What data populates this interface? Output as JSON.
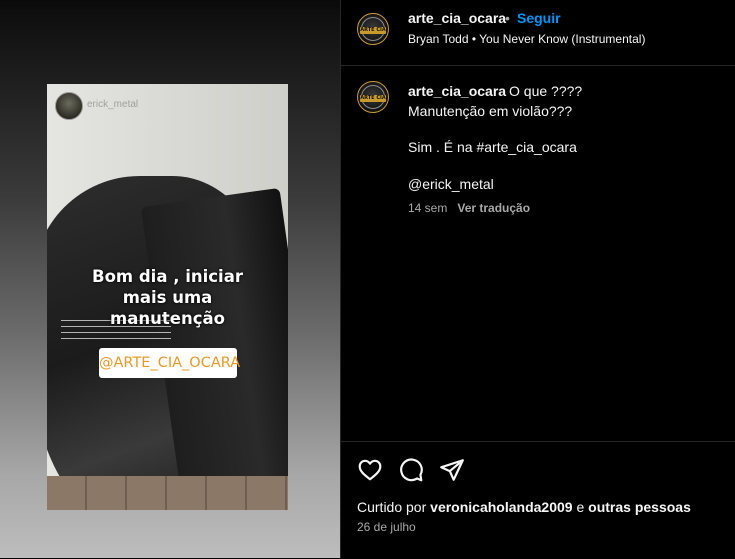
{
  "story": {
    "username_watermark": "erick_metal",
    "overlay_lines": [
      "Bom dia , iniciar",
      "mais uma",
      "manutenção"
    ],
    "tag": "@ARTE_CIA_OCARA"
  },
  "header": {
    "username": "arte_cia_ocara",
    "separator": "•",
    "follow_label": "Seguir",
    "audio": "Bryan Todd • You Never Know (Instrumental)",
    "logo_text": "ARTE CIA"
  },
  "caption": {
    "username": "arte_cia_ocara",
    "line1": "O que ????",
    "line2": "Manutenção em violão???",
    "line3": "Sim . É na #arte_cia_ocara",
    "line4": "@erick_metal",
    "age": "14 sem",
    "translate_label": "Ver tradução"
  },
  "footer": {
    "liked_prefix": "Curtido por",
    "liked_user": "veronicaholanda2009",
    "liked_mid": "e",
    "liked_rest": "outras pessoas",
    "date": "26 de julho"
  },
  "icons": {
    "like": "heart-icon",
    "comment": "comment-icon",
    "share": "share-icon"
  }
}
